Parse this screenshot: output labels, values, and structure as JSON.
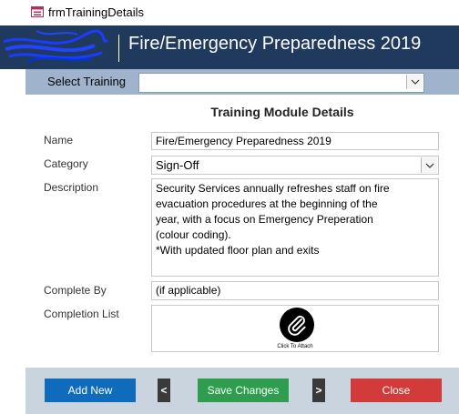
{
  "window": {
    "title": "frmTrainingDetails"
  },
  "header": {
    "title": "Fire/Emergency Preparedness 2019"
  },
  "select_bar": {
    "label": "Select Training",
    "value": ""
  },
  "section": {
    "title": "Training Module Details"
  },
  "form": {
    "name_label": "Name",
    "name_value": "Fire/Emergency Preparedness 2019",
    "category_label": "Category",
    "category_value": "Sign-Off",
    "description_label": "Description",
    "description_value": "Security Services annually refreshes staff on fire\nevacuation procedures at the beginning of the\nyear, with a focus on Emergency Preperation\n(colour coding).\n*With updated floor plan and exits",
    "complete_by_label": "Complete By",
    "complete_by_value": "(if applicable)",
    "completion_list_label": "Completion List",
    "attach_label": "Click To Attach"
  },
  "footer": {
    "add_label": "Add New",
    "prev_label": "<",
    "save_label": "Save Changes",
    "next_label": ">",
    "close_label": "Close"
  },
  "colors": {
    "header_bg": "#1f3a5c",
    "select_bar_bg": "#9fb4cc",
    "footer_bg": "#c9d4df",
    "add_button": "#0f6cbd",
    "save_button": "#2e9e4e",
    "close_button": "#d33a3a",
    "nav_button": "#3a3a3a"
  },
  "icons": [
    "form-icon",
    "chevron-down-icon",
    "paperclip-icon"
  ]
}
